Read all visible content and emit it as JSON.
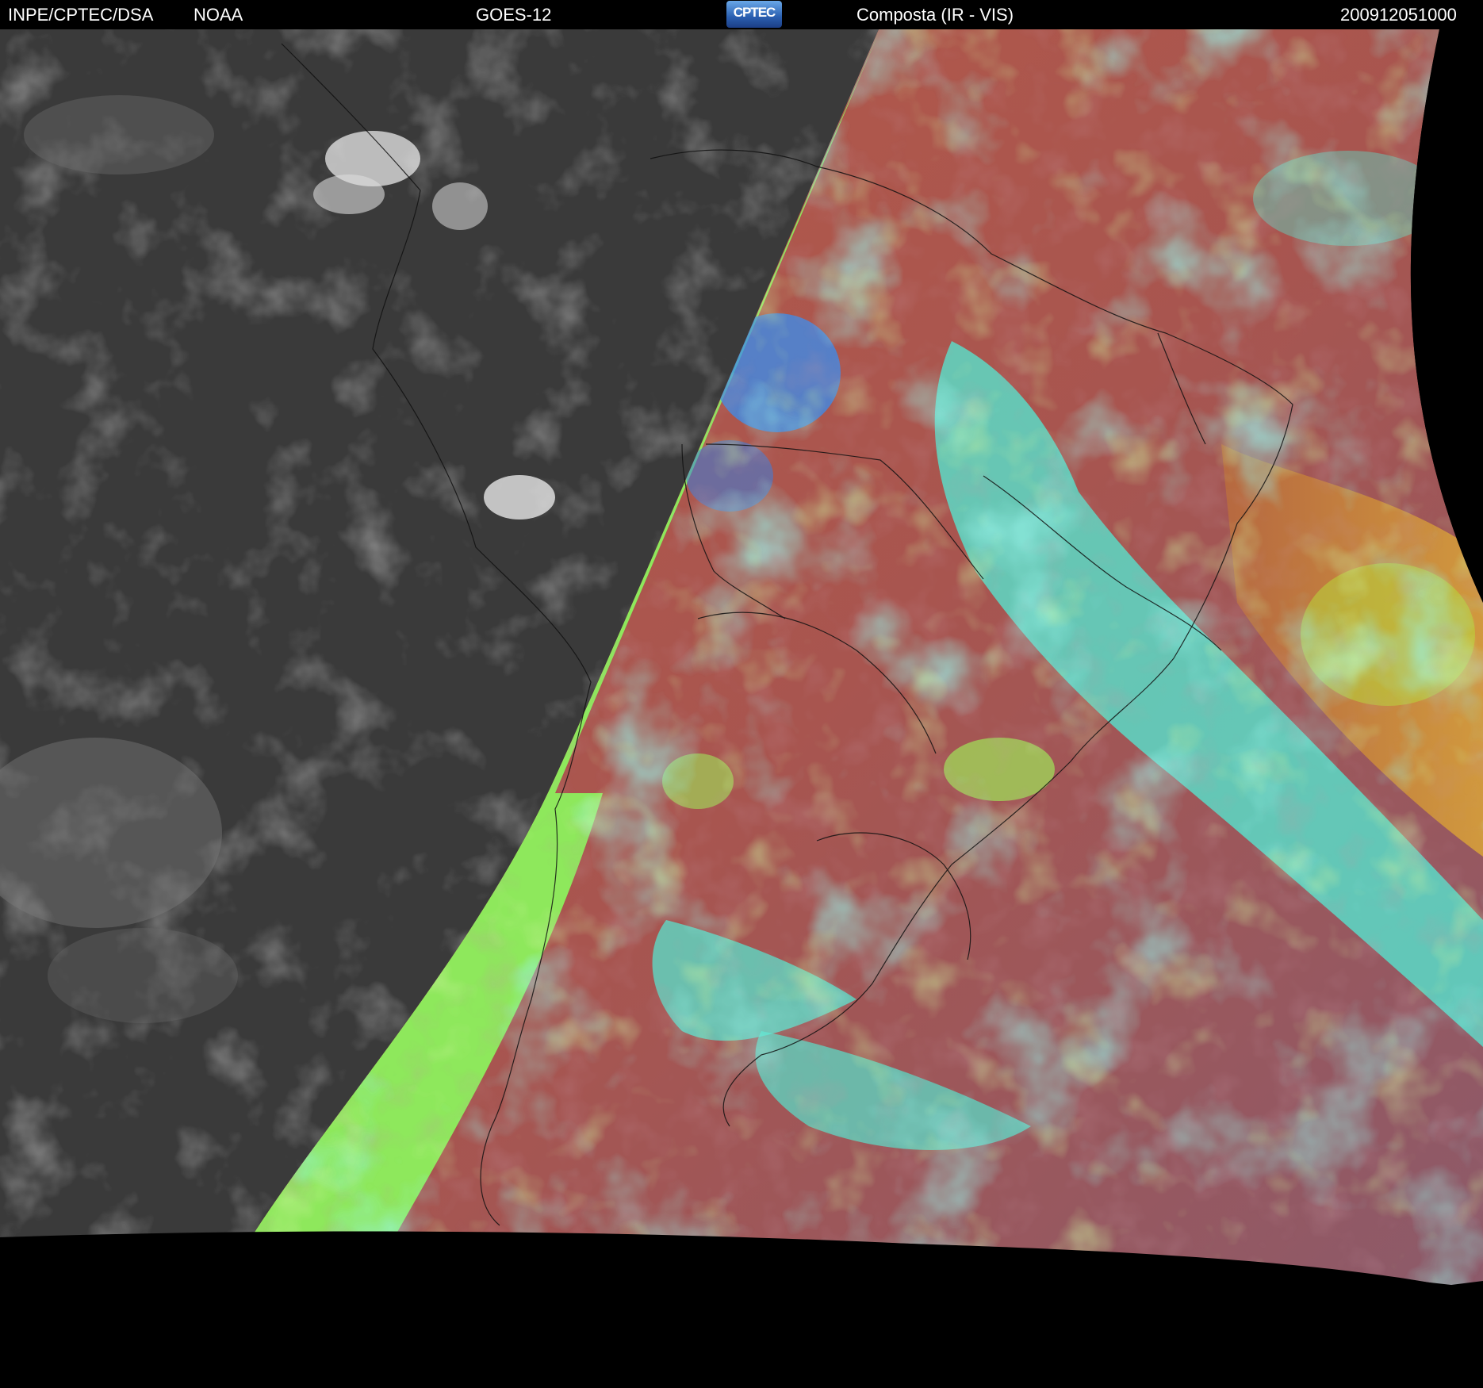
{
  "header": {
    "institution": "INPE/CPTEC/DSA",
    "agency": "NOAA",
    "satellite": "GOES-12",
    "logo_text": "CPTEC",
    "product": "Composta (IR - VIS)",
    "timestamp": "200912051000"
  },
  "colors": {
    "background": "#000000",
    "night_ir_gray": "#3a3a3a",
    "terminator_green": "#8ee85c",
    "land_red": "#b0574c",
    "cloud_cyan": "#52ecd6",
    "cloud_green": "#a0e65a",
    "cloud_blue": "#3a8ef0",
    "orange_region": "#c98a3a"
  }
}
